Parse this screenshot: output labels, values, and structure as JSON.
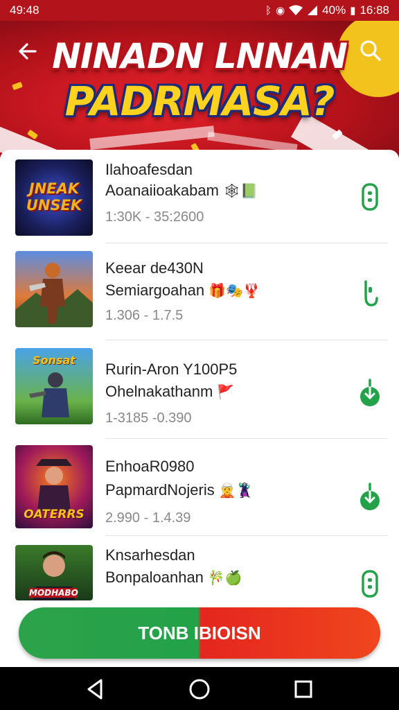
{
  "status_bar": {
    "time_left": "49:48",
    "battery": "40%",
    "time_right": "16:88"
  },
  "header": {
    "title_line1": "NINADN LNNAN",
    "title_line2": "PADRMASA?",
    "back_icon": "arrow-left-icon",
    "search_icon": "search-icon"
  },
  "list": [
    {
      "title": "Ilahoafesdan",
      "subtitle": "Aoanaiioakabam",
      "emoji": "🕸📗",
      "meta": "1:30K - 35:2600",
      "thumb_text": "JNEAK UNSEK",
      "action_icon": "phone-outline-icon"
    },
    {
      "title": "Keear de430N",
      "subtitle": "Semiargoahan",
      "emoji": "🎁🎭🦞",
      "meta": "1.306 - 1.7.5",
      "thumb_text": "",
      "action_icon": "hook-outline-icon"
    },
    {
      "title": "Rurin-Aron Y100P5",
      "subtitle": "Ohelnakathanm",
      "emoji": "🚩",
      "meta": "1-3185 -0.390",
      "thumb_text": "Sonsat",
      "action_icon": "download-circle-icon"
    },
    {
      "title": "EnhoaR0980",
      "subtitle": "PapmardNojeris",
      "emoji": "🧝🦹",
      "meta": "2.990 - 1.4.39",
      "thumb_text": "OATERRS",
      "action_icon": "download-circle-icon"
    },
    {
      "title": "Knsarhesdan",
      "subtitle": "Bonpaloanhan",
      "emoji": "🎋🍏",
      "meta": "",
      "thumb_text": "MODHABO",
      "action_icon": "phone-outline-icon"
    }
  ],
  "cta": {
    "label": "TONB IBIOISN"
  },
  "colors": {
    "accent_green": "#23a24a",
    "accent_red": "#e4261f",
    "banner_red": "#b5121b",
    "title_yellow": "#ffd21f"
  },
  "nav": {
    "back": "triangle-back-icon",
    "home": "circle-home-icon",
    "recents": "square-recents-icon"
  }
}
